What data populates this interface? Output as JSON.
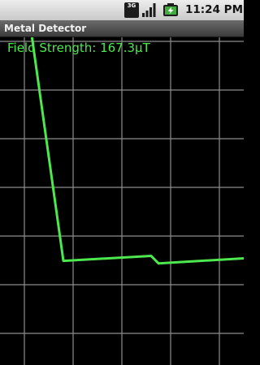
{
  "status_bar": {
    "network_top": "3G",
    "network_bottom": "",
    "time": "11:24 PM",
    "icons": [
      "network-3g-icon",
      "signal-icon",
      "battery-charging-icon"
    ]
  },
  "app": {
    "title": "Metal Detector"
  },
  "reading": {
    "field_strength_label": "Field Strength: 167.3μT"
  },
  "colors": {
    "trace": "#4de84d",
    "grid": "#8c8c8c",
    "background": "#000000"
  },
  "grid": {
    "columns": 5,
    "rows": 7
  },
  "chart_data": {
    "type": "line",
    "title": "",
    "xlabel": "",
    "ylabel": "",
    "grid": true,
    "xlim": [
      0,
      10
    ],
    "ylim": [
      0,
      7
    ],
    "series": [
      {
        "values_xy": [
          [
            0.6,
            7.0
          ],
          [
            1.3,
            2.1
          ],
          [
            3.1,
            2.2
          ],
          [
            3.25,
            2.05
          ],
          [
            5.0,
            2.15
          ]
        ]
      }
    ]
  }
}
